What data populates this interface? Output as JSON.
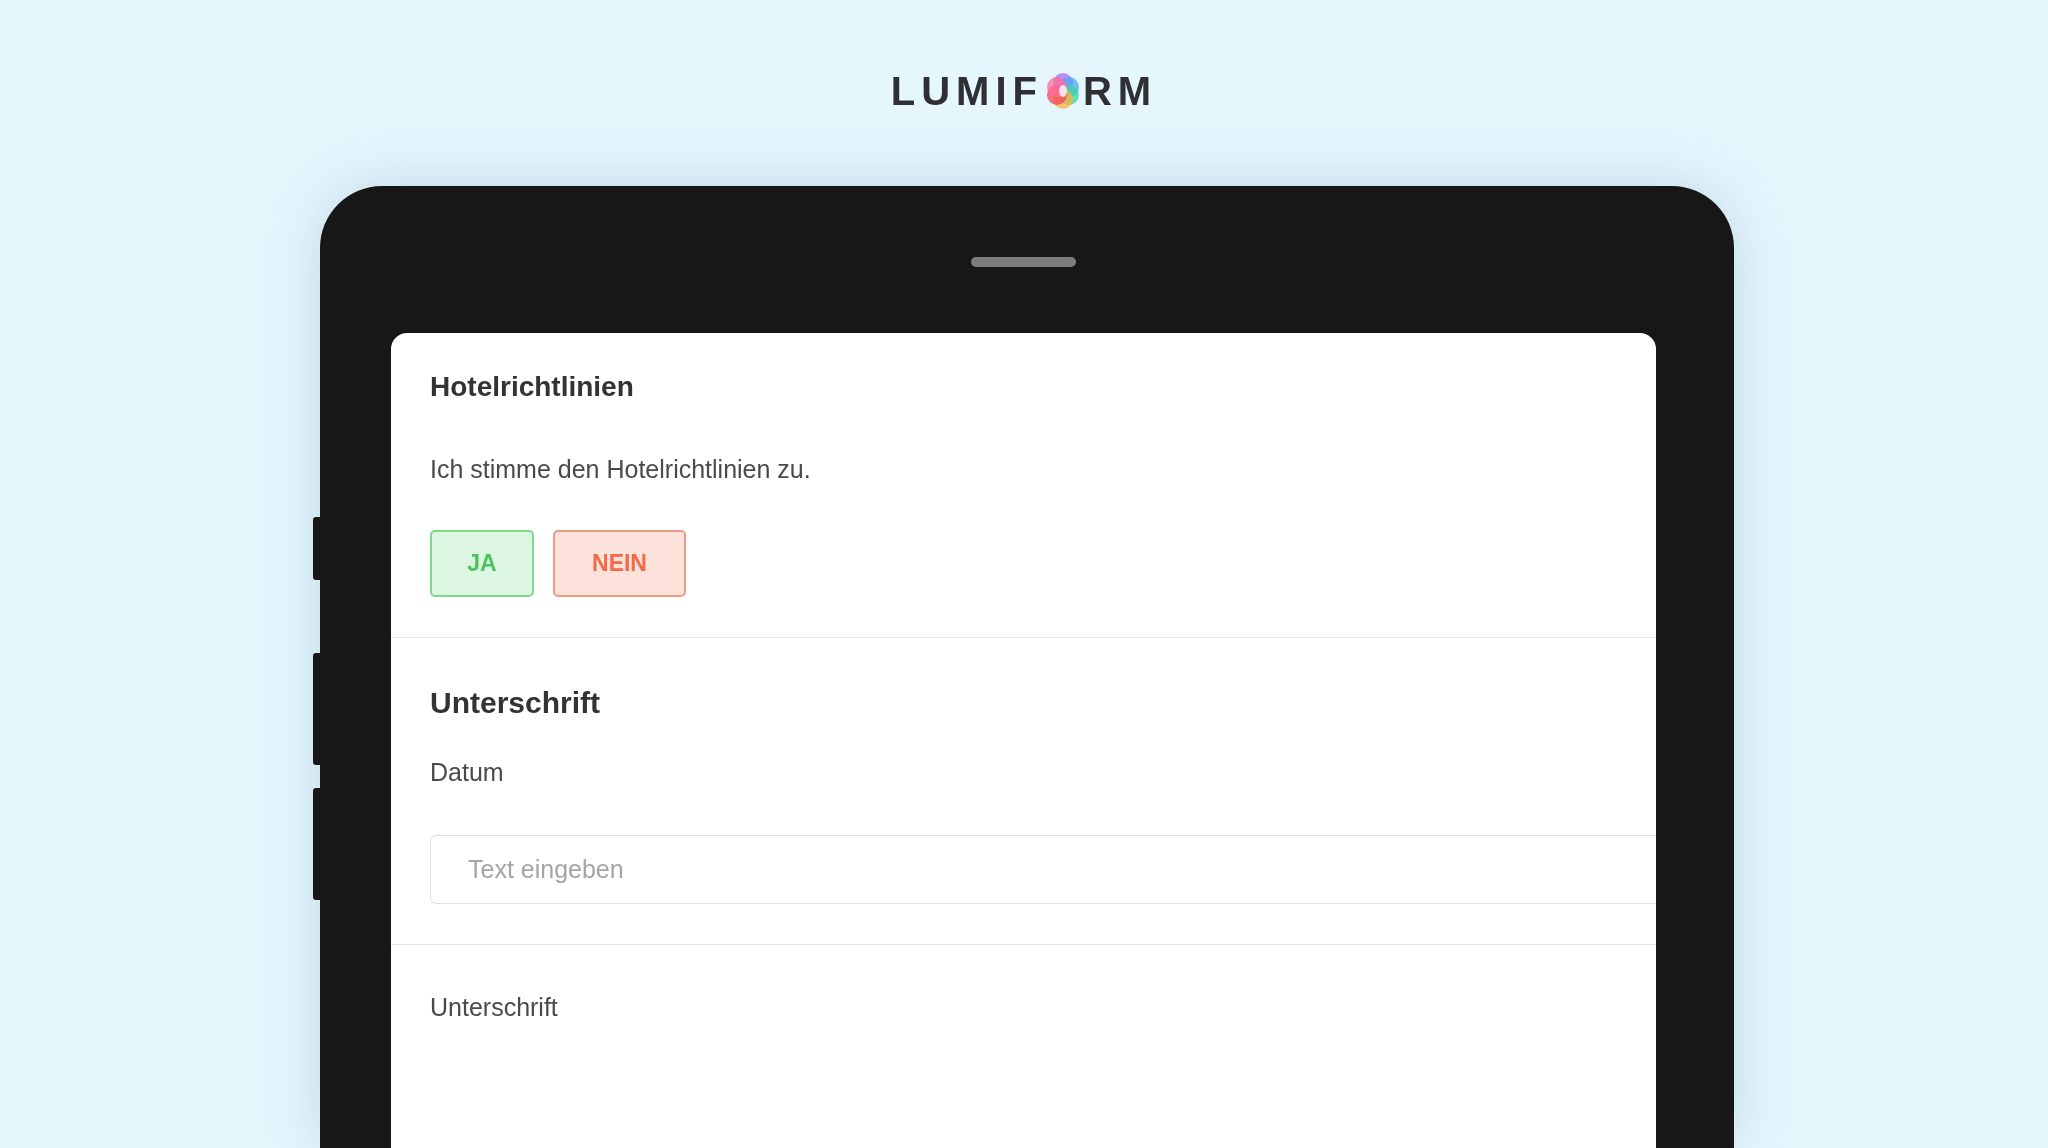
{
  "brand": {
    "before": "LUMIF",
    "after": "RM"
  },
  "sections": [
    {
      "title": "Hotelrichtlinien",
      "text": "Ich stimme den Hotelrichtlinien zu.",
      "options": [
        {
          "label": "JA",
          "kind": "yes"
        },
        {
          "label": "NEIN",
          "kind": "no"
        }
      ]
    },
    {
      "title": "Unterschrift",
      "field": {
        "label": "Datum",
        "placeholder": "Text eingeben"
      }
    },
    {
      "label": "Unterschrift"
    }
  ]
}
